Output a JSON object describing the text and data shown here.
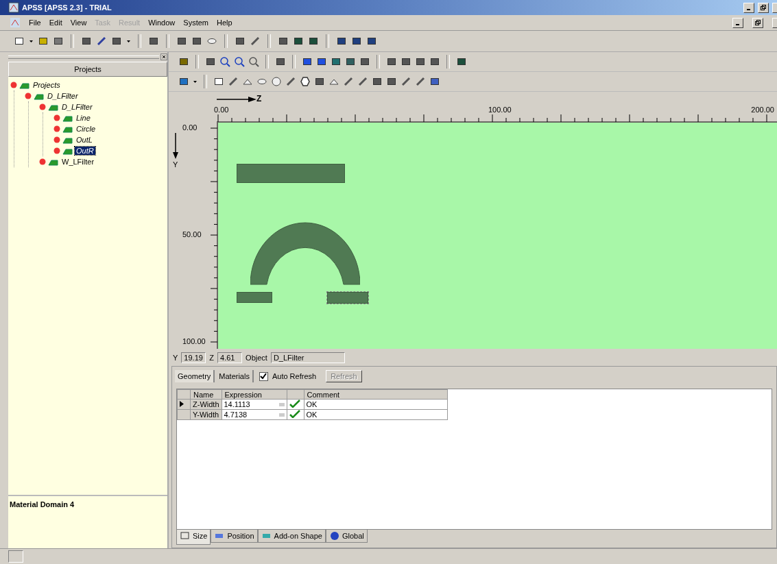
{
  "window": {
    "title": "APSS [APSS 2.3] - TRIAL"
  },
  "menu": [
    {
      "label": "File",
      "disabled": false
    },
    {
      "label": "Edit",
      "disabled": false
    },
    {
      "label": "View",
      "disabled": false
    },
    {
      "label": "Task",
      "disabled": true
    },
    {
      "label": "Result",
      "disabled": true
    },
    {
      "label": "Window",
      "disabled": false
    },
    {
      "label": "System",
      "disabled": false
    },
    {
      "label": "Help",
      "disabled": false
    }
  ],
  "projects_panel": {
    "title": "Projects",
    "tree": [
      {
        "label": "Projects",
        "italic": true,
        "selected": false,
        "children": [
          {
            "label": "D_LFilter",
            "italic": true,
            "selected": false,
            "children": [
              {
                "label": "D_LFilter",
                "italic": true,
                "selected": false,
                "children": [
                  {
                    "label": "Line",
                    "italic": true,
                    "selected": false
                  },
                  {
                    "label": "Circle",
                    "italic": true,
                    "selected": false
                  },
                  {
                    "label": "OutL",
                    "italic": true,
                    "selected": false
                  },
                  {
                    "label": "OutR",
                    "italic": true,
                    "selected": true
                  }
                ]
              },
              {
                "label": "W_LFilter",
                "italic": false,
                "selected": false
              }
            ]
          }
        ]
      }
    ],
    "footer": "Material Domain 4"
  },
  "canvas": {
    "z_axis": "Z",
    "y_axis": "Y",
    "top_ticks": [
      "0.00",
      "100.00",
      "200.00"
    ],
    "left_ticks": [
      "0.00",
      "50.00",
      "100.00"
    ]
  },
  "coords": {
    "y_label": "Y",
    "y_value": "19.19",
    "z_label": "Z",
    "z_value": "4.61",
    "object_label": "Object",
    "object_value": "D_LFilter"
  },
  "tabs": [
    {
      "label": "Geometry",
      "selected": true
    },
    {
      "label": "Materials",
      "selected": false
    }
  ],
  "auto_refresh": {
    "label": "Auto Refresh",
    "checked": true
  },
  "refresh_button": {
    "label": "Refresh",
    "disabled": true
  },
  "table": {
    "columns": [
      "Name",
      "Expression",
      "Comment"
    ],
    "rows": [
      {
        "name": "Z-Width",
        "expression": "14.1113",
        "comment": "OK",
        "selected": true
      },
      {
        "name": "Y-Width",
        "expression": "4.7138",
        "comment": "OK",
        "selected": false
      }
    ]
  },
  "bottom_tabs": [
    {
      "label": "Size",
      "selected": true
    },
    {
      "label": "Position",
      "selected": false
    },
    {
      "label": "Add-on Shape",
      "selected": false
    },
    {
      "label": "Global",
      "selected": false
    }
  ]
}
